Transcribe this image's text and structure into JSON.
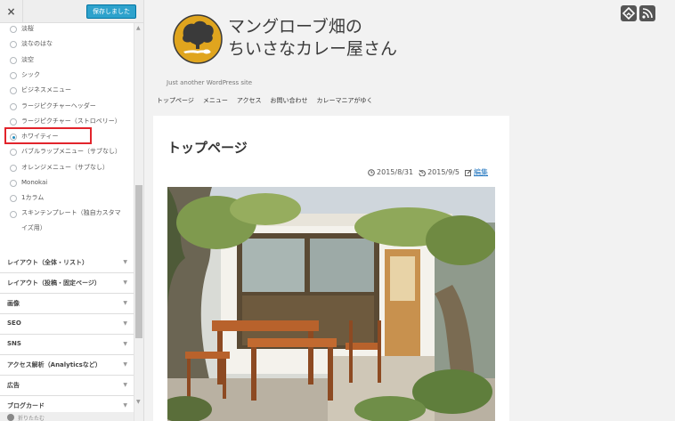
{
  "customizer": {
    "close_label": "×",
    "save_label": "保存しました",
    "skins": [
      {
        "label": "淡桜",
        "checked": false
      },
      {
        "label": "淡なのはな",
        "checked": false
      },
      {
        "label": "淡空",
        "checked": false
      },
      {
        "label": "シック",
        "checked": false
      },
      {
        "label": "ビジネスメニュー",
        "checked": false
      },
      {
        "label": "ラージピクチャーヘッダー",
        "checked": false
      },
      {
        "label": "ラージピクチャー（ストロベリー）",
        "checked": false
      },
      {
        "label": "ホワイティー",
        "checked": true
      },
      {
        "label": "バブルラップメニュー（サブなし）",
        "checked": false
      },
      {
        "label": "オレンジメニュー（サブなし）",
        "checked": false
      },
      {
        "label": "Monokai",
        "checked": false
      },
      {
        "label": "1カラム",
        "checked": false
      },
      {
        "label": "スキンテンプレート（独自カスタマイズ用）",
        "checked": false
      }
    ],
    "sections": [
      "レイアウト（全体・リスト）",
      "レイアウト（投稿・固定ページ）",
      "画像",
      "SEO",
      "SNS",
      "アクセス解析（Analyticsなど）",
      "広告",
      "ブログカード"
    ],
    "collapse_label": "折りたたむ"
  },
  "site": {
    "title_line1": "マングローブ畑の",
    "title_line2": "ちいさなカレー屋さん",
    "tagline": "Just another WordPress site",
    "nav": [
      "トップページ",
      "メニュー",
      "アクセス",
      "お問い合わせ",
      "カレーマニアがゆく"
    ],
    "social_icons": [
      "feedly-icon",
      "rss-icon"
    ]
  },
  "post": {
    "title": "トップページ",
    "published": "2015/8/31",
    "updated": "2015/9/5",
    "edit_label": "編集"
  },
  "colors": {
    "accent": "#2ea2cc",
    "highlight": "#e2242b",
    "logo": "#e0a51e",
    "link": "#1e73be"
  }
}
